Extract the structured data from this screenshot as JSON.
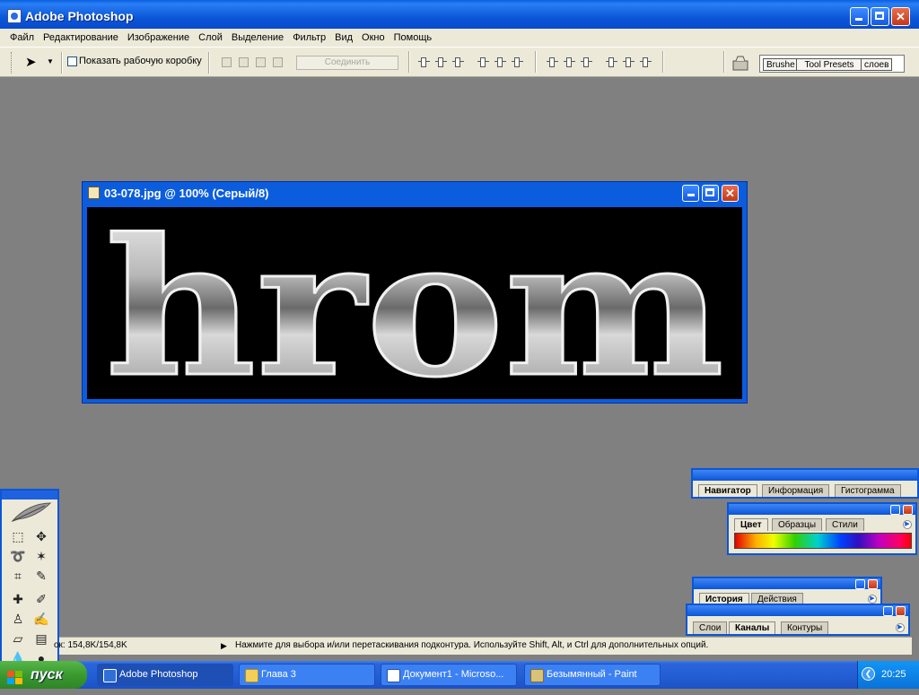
{
  "window": {
    "title": "Adobe Photoshop"
  },
  "menu": [
    "Файл",
    "Редактирование",
    "Изображение",
    "Слой",
    "Выделение",
    "Фильтр",
    "Вид",
    "Окно",
    "Помощь"
  ],
  "toolbar": {
    "show_bbox_label": "Показать рабочую коробку",
    "join_label": "Соединить",
    "palette_well_tabs": [
      "Brushe",
      "Tool Presets",
      "слоев"
    ]
  },
  "document": {
    "title": "03-078.jpg @ 100% (Серый/8)",
    "text": "hrom"
  },
  "status": {
    "doc_size": "ок: 154,8K/154,8K",
    "hint": "Нажмите для выбора и/или перетаскивания подконтура.  Используйте Shift, Alt, и Ctrl для дополнительных опций."
  },
  "palettes": {
    "navigator": [
      "Навигатор",
      "Информация",
      "Гистограмма"
    ],
    "color": [
      "Цвет",
      "Образцы",
      "Стили"
    ],
    "history": [
      "История",
      "Действия"
    ],
    "layers": [
      "Слои",
      "Каналы",
      "Контуры"
    ]
  },
  "taskbar": {
    "start": "пуск",
    "items": [
      "Adobe Photoshop",
      "Глава 3",
      "Документ1 - Microso...",
      "Безымянный - Paint"
    ],
    "clock": "20:25"
  },
  "colors": {
    "xp_blue": "#0b56d8",
    "workspace": "#808080",
    "chrome": "#ece9d8"
  }
}
